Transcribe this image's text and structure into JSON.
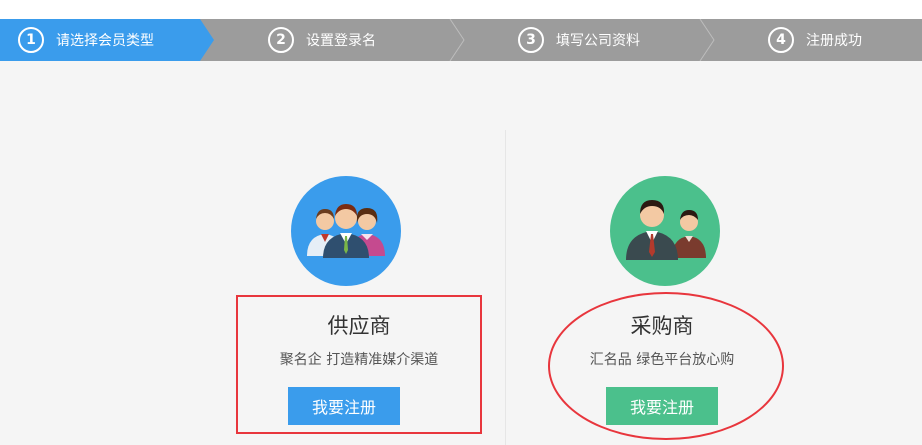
{
  "steps": [
    {
      "num": "1",
      "label": "请选择会员类型",
      "active": true
    },
    {
      "num": "2",
      "label": "设置登录名",
      "active": false
    },
    {
      "num": "3",
      "label": "填写公司资料",
      "active": false
    },
    {
      "num": "4",
      "label": "注册成功",
      "active": false
    }
  ],
  "colors": {
    "active_step": "#3a9cec",
    "inactive_step": "#9c9c9c",
    "supplier_accent": "#3a9cec",
    "buyer_accent": "#4bc08c",
    "highlight": "#e8363d"
  },
  "supplier": {
    "title": "供应商",
    "description": "聚名企 打造精准媒介渠道",
    "button_label": "我要注册",
    "icon": "group-people-icon"
  },
  "buyer": {
    "title": "采购商",
    "description": "汇名品 绿色平台放心购",
    "button_label": "我要注册",
    "icon": "two-people-icon"
  }
}
